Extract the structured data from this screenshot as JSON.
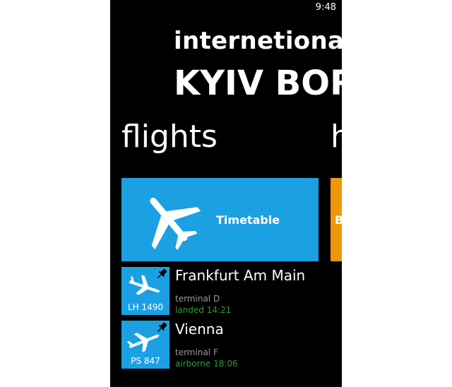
{
  "status_bar": {
    "time": "9:48"
  },
  "header": {
    "title": "internetional",
    "subtitle": "KYIV BOR"
  },
  "pivot": {
    "active": "flights",
    "next": "h"
  },
  "tiles": {
    "timetable": {
      "label": "Timetable",
      "icon": "airplane-icon",
      "color": "#1ba1e2"
    },
    "second": {
      "label": "B",
      "color": "#f09609"
    }
  },
  "flights": [
    {
      "code": "LH 1490",
      "city": "Frankfurt Am Main",
      "terminal": "terminal D",
      "status": "landed 14:21",
      "icon": "landing-airplane-icon",
      "pinned": true
    },
    {
      "code": "PS 847",
      "city": "Vienna",
      "terminal": "terminal F",
      "status": "airborne 18:06",
      "icon": "takeoff-airplane-icon",
      "pinned": true
    }
  ],
  "colors": {
    "accent": "#1ba1e2",
    "orange": "#f09609",
    "status_green": "#339933"
  }
}
